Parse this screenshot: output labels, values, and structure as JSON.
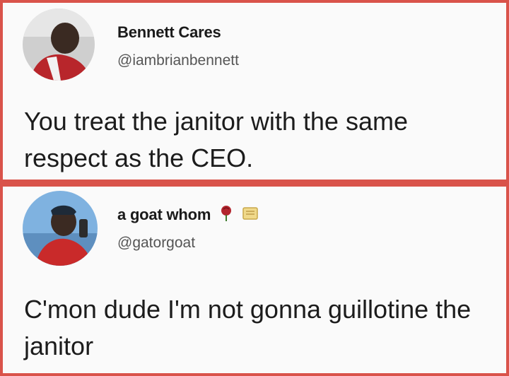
{
  "tweets": [
    {
      "name": "Bennett Cares",
      "handle": "@iambrianbennett",
      "text": "You treat the janitor with the same respect as the CEO."
    },
    {
      "name": "a goat whom",
      "handle": "@gatorgoat",
      "text": "C'mon dude I'm not gonna guillotine the janitor",
      "name_emojis": [
        "rose-icon",
        "scroll-icon"
      ]
    }
  ],
  "colors": {
    "frame": "#d9534a",
    "card": "#fafafa",
    "text": "#1c1c1c",
    "handle": "#555555"
  }
}
